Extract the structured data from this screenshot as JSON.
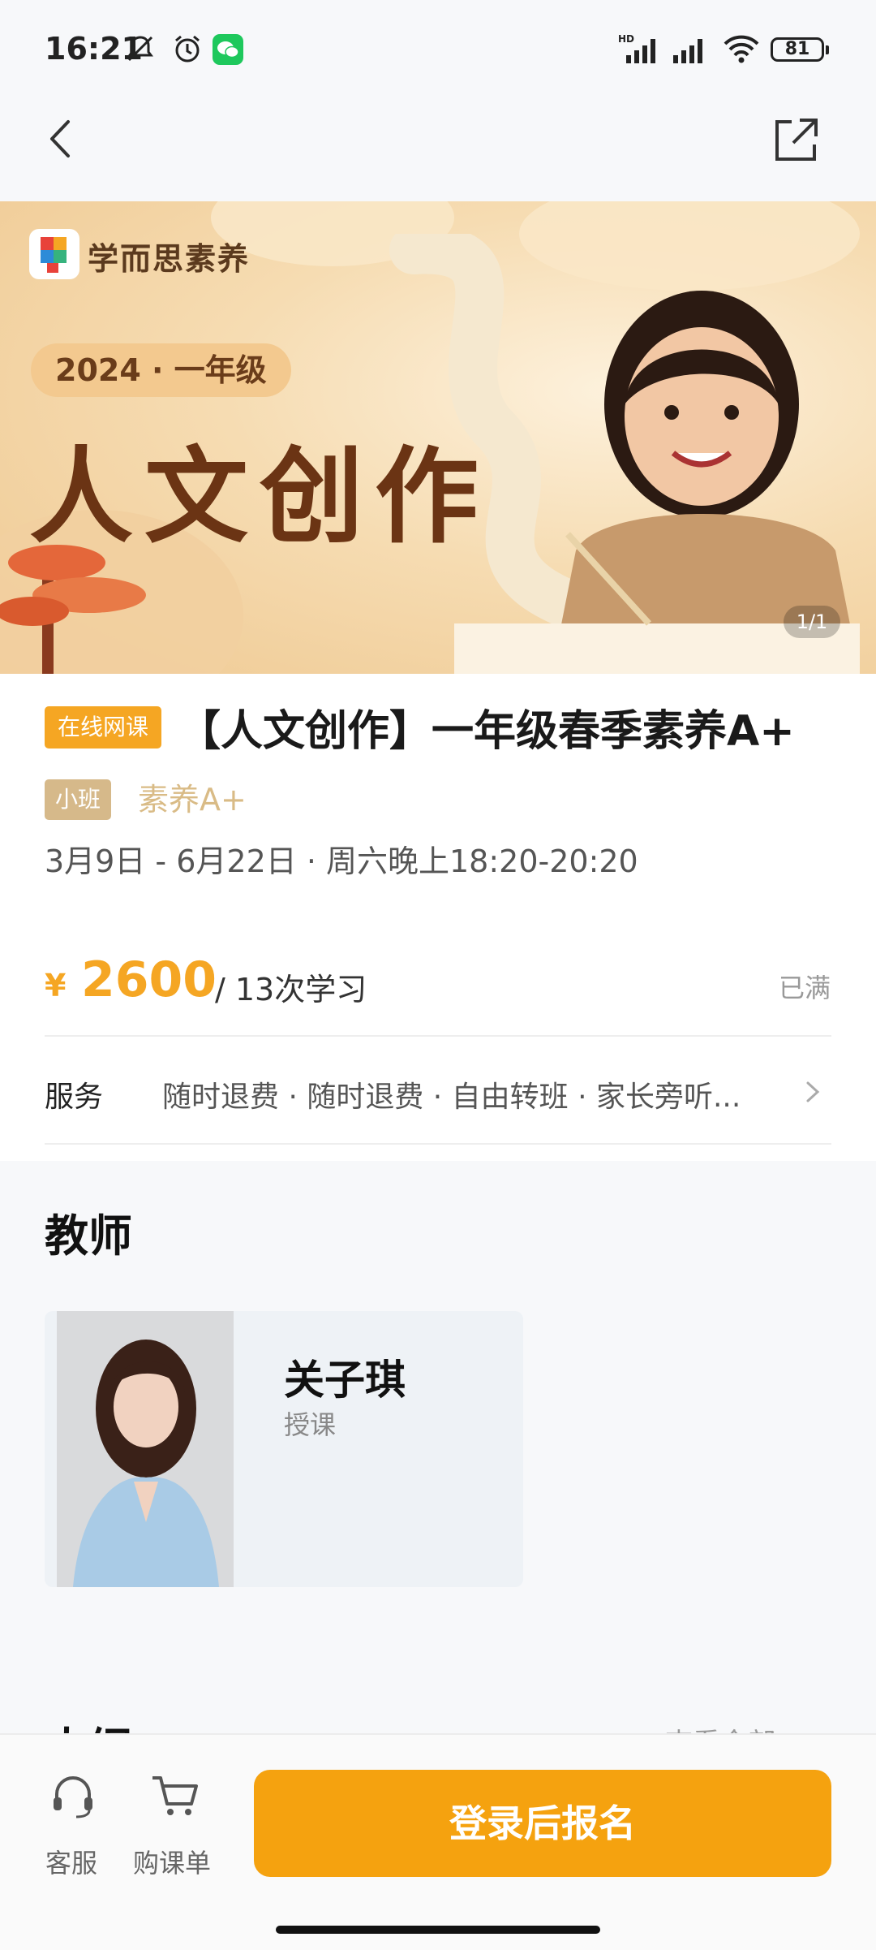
{
  "status_bar": {
    "time": "16:21",
    "battery": "81",
    "icons": [
      "mute-icon",
      "alarm-icon",
      "wechat-icon",
      "hd-signal-icon",
      "signal-icon",
      "wifi-icon",
      "battery-icon"
    ]
  },
  "nav": {
    "back_icon": "chevron-left-icon",
    "share_icon": "share-icon"
  },
  "banner": {
    "brand_name": "学而思素养",
    "grade": "2024 · 一年级",
    "title": "人文创作",
    "page_indicator": "1/1"
  },
  "course": {
    "online_tag": "在线网课",
    "title": "【人文创作】一年级春季素养A+",
    "class_tag": "小班",
    "level": "素养A+",
    "schedule": "3月9日 - 6月22日 · 周六晚上18:20-20:20",
    "price_symbol": "¥",
    "price": "2600",
    "price_unit": "/ 13次学习",
    "status": "已满",
    "service_label": "服务",
    "services": "随时退费 · 随时退费 · 自由转班 · 家长旁听..."
  },
  "teacher": {
    "heading": "教师",
    "name": "关子琪",
    "role": "授课"
  },
  "outline": {
    "heading": "大纲",
    "view_all": "查看全部"
  },
  "bottom_bar": {
    "customer_service": "客服",
    "cart": "购课单",
    "signup": "登录后报名"
  },
  "colors": {
    "accent": "#f5a20f",
    "tag_orange": "#f5a623",
    "class_tag": "#d6b98a",
    "banner_title": "#6b3414"
  }
}
